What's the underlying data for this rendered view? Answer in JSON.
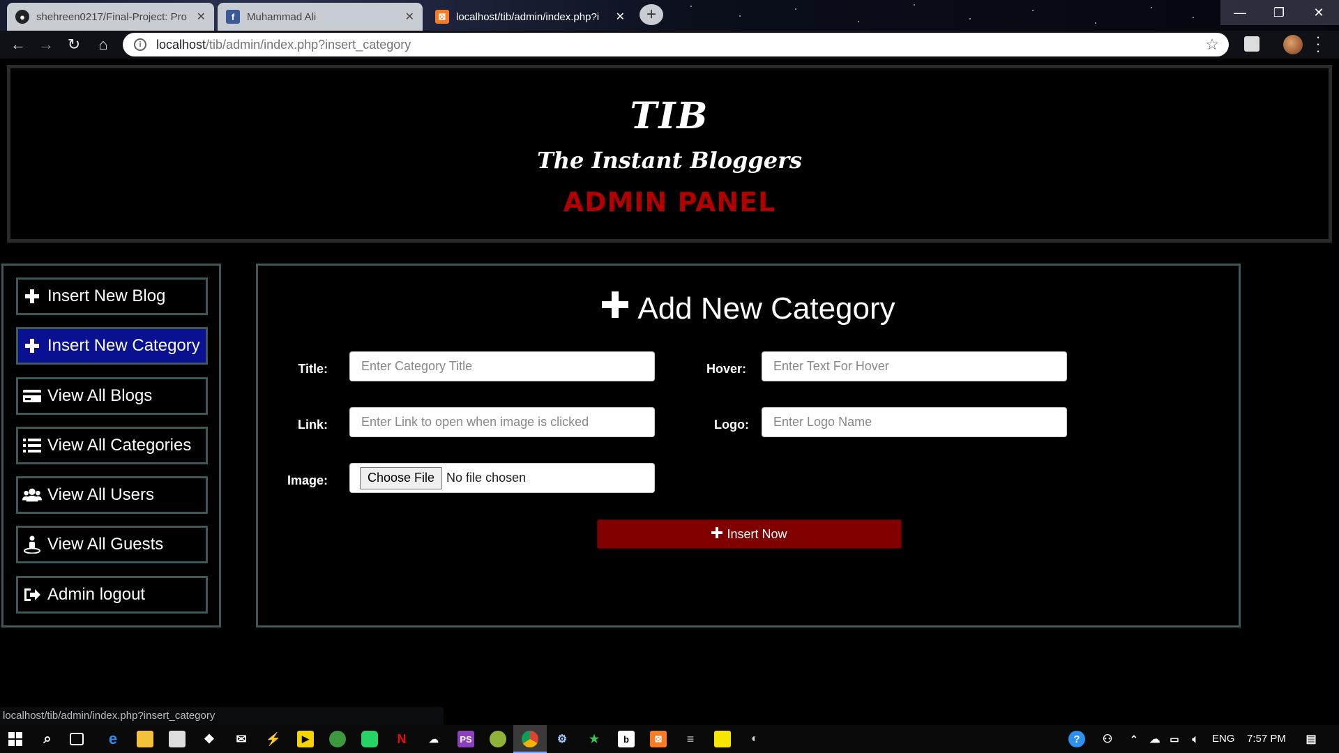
{
  "browser": {
    "tabs": [
      {
        "title": "shehreen0217/Final-Project: Pro",
        "favicon": "github-icon"
      },
      {
        "title": "Muhammad Ali",
        "favicon": "facebook-icon"
      },
      {
        "title": "localhost/tib/admin/index.php?i",
        "favicon": "xampp-icon"
      }
    ],
    "new_tab": "+",
    "url_host": "localhost",
    "url_path": "/tib/admin/index.php?insert_category"
  },
  "header": {
    "site_title": "TIB",
    "tagline": "The Instant Bloggers",
    "panel_title": "ADMIN PANEL"
  },
  "sidebar": {
    "items": [
      {
        "label": "Insert New Blog",
        "icon": "plus-icon"
      },
      {
        "label": "Insert New Category",
        "icon": "plus-icon",
        "active": true
      },
      {
        "label": "View All Blogs",
        "icon": "credit-card-icon"
      },
      {
        "label": "View All Categories",
        "icon": "list-icon"
      },
      {
        "label": "View All Users",
        "icon": "users-icon"
      },
      {
        "label": "View All Guests",
        "icon": "guest-icon"
      },
      {
        "label": "Admin logout",
        "icon": "logout-icon"
      }
    ]
  },
  "form": {
    "heading": "Add New Category",
    "title_label": "Title:",
    "title_placeholder": "Enter Category Title",
    "hover_label": "Hover:",
    "hover_placeholder": "Enter Text For Hover",
    "link_label": "Link:",
    "link_placeholder": "Enter Link to open when image is clicked",
    "logo_label": "Logo:",
    "logo_placeholder": "Enter Logo Name",
    "image_label": "Image:",
    "file_button": "Choose File",
    "file_status": "No file chosen",
    "submit_label": "Insert Now"
  },
  "status_bar": "localhost/tib/admin/index.php?insert_category",
  "taskbar": {
    "language": "ENG",
    "time": "7:57 PM"
  },
  "colors": {
    "active_sidebar": "#0a1191",
    "panel_title": "#b00000",
    "submit_button": "#800000",
    "border": "#3d5857"
  }
}
